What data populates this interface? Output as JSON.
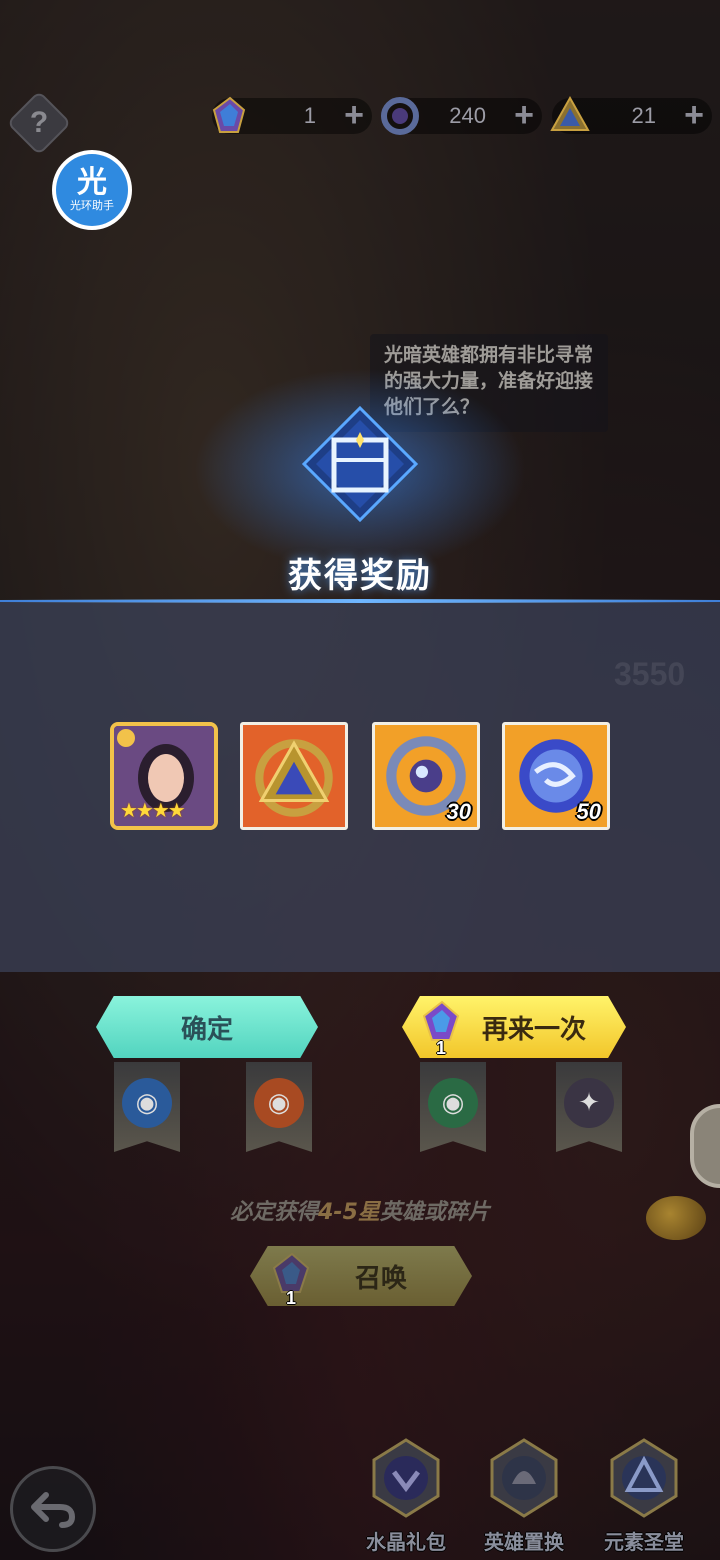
{
  "currencies": [
    {
      "icon": "crystal-icon",
      "value": "1",
      "plus": "+"
    },
    {
      "icon": "ring-orb-icon",
      "value": "240",
      "plus": "+"
    },
    {
      "icon": "triangle-emblem-icon",
      "value": "21",
      "plus": "+"
    }
  ],
  "help_label": "?",
  "helper": {
    "big": "光",
    "small": "光环助手"
  },
  "hint_text": "光暗英雄都拥有非比寻常的强大力量，准备好迎接他们了么？",
  "background_number": "3550",
  "reward": {
    "title": "获得奖励",
    "items": [
      {
        "name": "hero-card",
        "stars": "★★★★",
        "count": ""
      },
      {
        "name": "element-emblem",
        "count": ""
      },
      {
        "name": "ring-orb",
        "count": "30"
      },
      {
        "name": "blue-orb",
        "count": "50"
      }
    ]
  },
  "buttons": {
    "confirm": "确定",
    "again": "再来一次",
    "again_cost": "1",
    "summon": "召唤",
    "summon_cost": "1"
  },
  "guarantee": {
    "prefix": "必定获得",
    "highlight": "4-5星",
    "suffix": "英雄或碎片"
  },
  "bottom_nav": [
    {
      "label": "水晶礼包",
      "icon": "crystal-gift-icon"
    },
    {
      "label": "英雄置换",
      "icon": "hero-swap-icon"
    },
    {
      "label": "元素圣堂",
      "icon": "element-temple-icon"
    }
  ],
  "colors": {
    "confirm_bg": "#52d4bf",
    "again_bg": "#f2c62a",
    "panel_line": "#3f7fd8",
    "hero_frame": "#f2c24a"
  }
}
